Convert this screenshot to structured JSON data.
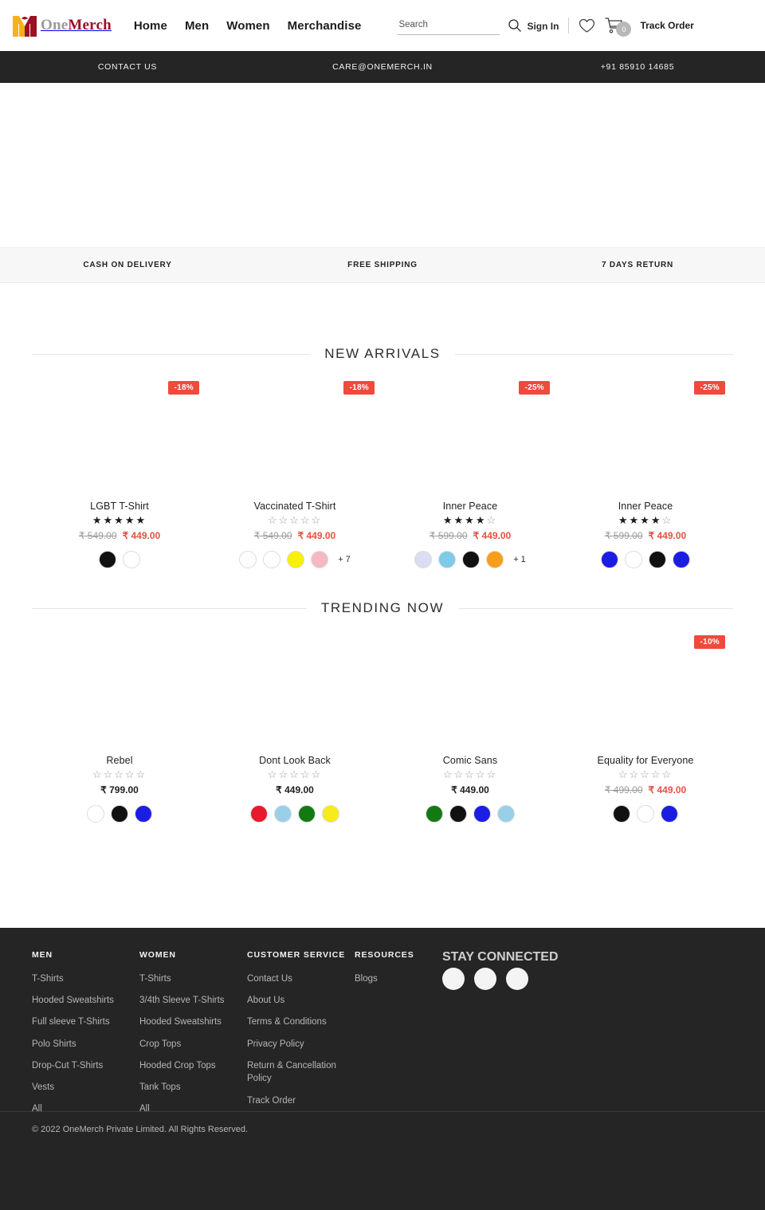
{
  "brand": {
    "name_part1": "One",
    "name_part2": "Merch",
    "logo_icon": "m-monogram-logo",
    "logo_color_left": "#f5b21a",
    "logo_color_right": "#9c1024"
  },
  "header": {
    "nav": [
      {
        "label": "Home"
      },
      {
        "label": "Men"
      },
      {
        "label": "Women"
      },
      {
        "label": "Merchandise"
      }
    ],
    "search": {
      "placeholder": "Search",
      "value": "",
      "icon": "search-icon"
    },
    "sign_in": "Sign In",
    "wishlist_icon": "heart-icon",
    "cart_icon": "cart-icon",
    "cart_count": "0",
    "track_order": "Track Order"
  },
  "contact_bar": {
    "items": [
      "CONTACT US",
      "CARE@ONEMERCH.IN",
      "+91 85910 14685"
    ],
    "background": "#252525"
  },
  "benefits": {
    "items": [
      "CASH ON DELIVERY",
      "FREE SHIPPING",
      "7 DAYS RETURN"
    ]
  },
  "sections": [
    {
      "title": "NEW ARRIVALS",
      "products": [
        {
          "name": "LGBT T-Shirt",
          "discount_badge": "-18%",
          "rating": 5,
          "price_old": "₹ 549.00",
          "price_new": "₹ 449.00",
          "swatches": [
            "#111111",
            "#ffffff"
          ],
          "swatch_more": ""
        },
        {
          "name": "Vaccinated T-Shirt",
          "discount_badge": "-18%",
          "rating": 0,
          "price_old": "₹ 549.00",
          "price_new": "₹ 449.00",
          "swatches": [
            "#fdfdfd",
            "#ffffff",
            "#f7f009",
            "#f6b8c4"
          ],
          "swatch_more": "+ 7"
        },
        {
          "name": "Inner Peace",
          "discount_badge": "-25%",
          "rating": 4,
          "price_old": "₹ 599.00",
          "price_new": "₹ 449.00",
          "swatches": [
            "#dcdcf2",
            "#7ecbe8",
            "#111111",
            "#f79e1b"
          ],
          "swatch_more": "+ 1"
        },
        {
          "name": "Inner Peace",
          "discount_badge": "-25%",
          "rating": 4,
          "price_old": "₹ 599.00",
          "price_new": "₹ 449.00",
          "swatches": [
            "#1b1ee0",
            "#ffffff",
            "#111111",
            "#1b1ee0"
          ],
          "swatch_more": ""
        }
      ]
    },
    {
      "title": "TRENDING NOW",
      "products": [
        {
          "name": "Rebel",
          "discount_badge": "",
          "rating": 0,
          "price_old": "",
          "price_new": "₹ 799.00",
          "swatches": [
            "#ffffff",
            "#111111",
            "#1b1ee0"
          ],
          "swatch_more": ""
        },
        {
          "name": "Dont Look Back",
          "discount_badge": "",
          "rating": 0,
          "price_old": "",
          "price_new": "₹ 449.00",
          "swatches": [
            "#e8192c",
            "#9acfe8",
            "#137a13",
            "#f5ec1a"
          ],
          "swatch_more": ""
        },
        {
          "name": "Comic Sans",
          "discount_badge": "",
          "rating": 0,
          "price_old": "",
          "price_new": "₹ 449.00",
          "swatches": [
            "#137a13",
            "#111111",
            "#1b1ee0",
            "#9acfe8"
          ],
          "swatch_more": ""
        },
        {
          "name": "Equality for Everyone",
          "discount_badge": "-10%",
          "rating": 0,
          "price_old": "₹ 499.00",
          "price_new": "₹ 449.00",
          "swatches": [
            "#111111",
            "#ffffff",
            "#1b1ee0"
          ],
          "swatch_more": ""
        }
      ]
    }
  ],
  "footer": {
    "columns": [
      {
        "heading": "MEN",
        "links": [
          "T-Shirts",
          "Hooded Sweatshirts",
          "Full sleeve T-Shirts",
          "Polo Shirts",
          "Drop-Cut T-Shirts",
          "Vests",
          "All"
        ]
      },
      {
        "heading": "WOMEN",
        "links": [
          "T-Shirts",
          "3/4th Sleeve T-Shirts",
          "Hooded Sweatshirts",
          "Crop Tops",
          "Hooded Crop Tops",
          "Tank Tops",
          "All"
        ]
      },
      {
        "heading": "CUSTOMER SERVICE",
        "links": [
          "Contact Us",
          "About Us",
          "Terms & Conditions",
          "Privacy Policy",
          "Return & Cancellation Policy",
          "Track Order"
        ]
      },
      {
        "heading": "RESOURCES",
        "links": [
          "Blogs"
        ]
      }
    ],
    "social_heading": "STAY CONNECTED",
    "socials": [
      "social-icon-1",
      "social-icon-2",
      "social-icon-3"
    ],
    "copyright": "© 2022 OneMerch Private Limited. All Rights Reserved."
  },
  "theme": {
    "accent_red": "#ef4a3c",
    "dark": "#252525",
    "price_sale": "#e8503f"
  }
}
